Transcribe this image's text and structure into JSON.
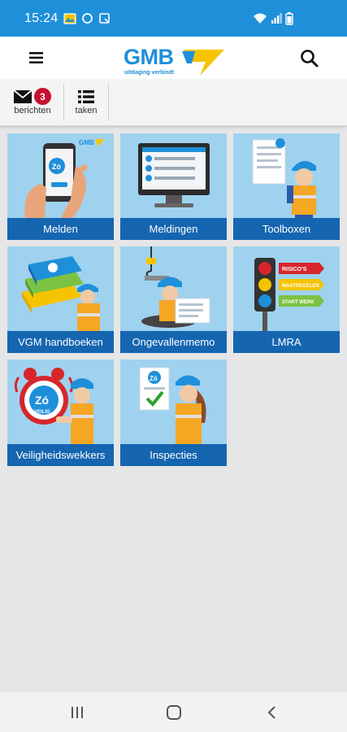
{
  "status_bar": {
    "time": "15:24",
    "background_color": "#1e8fd9",
    "icons": [
      "gallery-notification-icon",
      "circle-notification-icon",
      "screenshot-notification-icon",
      "wifi-icon",
      "signal-icon",
      "battery-icon"
    ]
  },
  "app_bar": {
    "logo_text": "GMB",
    "logo_tagline": "uitdaging verbindt",
    "brand_blue": "#1e8fd9",
    "brand_yellow": "#f5c400"
  },
  "tabs": [
    {
      "label": "berichten",
      "badge": "3",
      "icon": "mail-icon"
    },
    {
      "label": "taken",
      "icon": "task-list-icon"
    }
  ],
  "tiles": [
    {
      "label": "Melden",
      "icon": "phone-report-icon"
    },
    {
      "label": "Meldingen",
      "icon": "monitor-list-icon"
    },
    {
      "label": "Toolboxen",
      "icon": "worker-document-icon"
    },
    {
      "label": "VGM handboeken",
      "icon": "books-icon"
    },
    {
      "label": "Ongevallenmemo",
      "icon": "accident-memo-icon"
    },
    {
      "label": "LMRA",
      "icon": "traffic-light-icon"
    },
    {
      "label": "Veiligheidswekkers",
      "icon": "alarm-clock-icon"
    },
    {
      "label": "Inspecties",
      "icon": "inspection-checklist-icon"
    }
  ],
  "tile_art_texts": {
    "traffic_light_signs": [
      "RISICO'S",
      "MAATREGELEN",
      "START WERK"
    ],
    "zo_badge": "Zó",
    "zo_sub": "VEILIG"
  },
  "colors": {
    "tile_background": "#9fd2ef",
    "tile_caption": "#1565b0",
    "badge": "#c8102e"
  }
}
